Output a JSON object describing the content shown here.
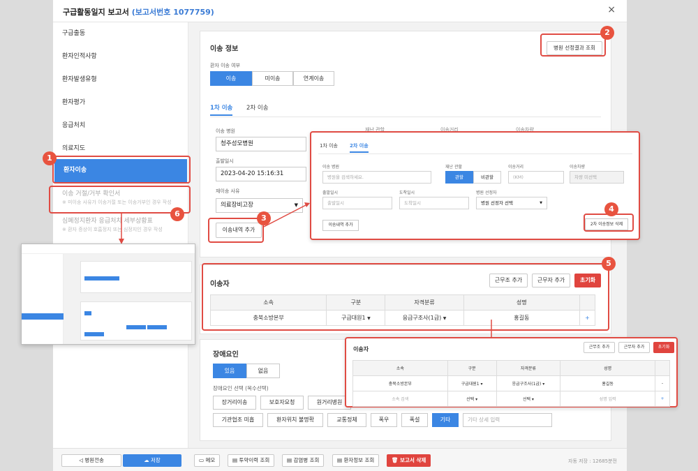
{
  "window": {
    "title": "구급활동일지 보고서",
    "report_no": "(보고서번호 1077759)",
    "close_icon": "×"
  },
  "sidebar": {
    "items": [
      "구급출동",
      "환자인적사항",
      "환자발생유형",
      "환자평가",
      "응급처치",
      "의료지도",
      "환자이송"
    ],
    "refusal_title": "이송 거절/거부 확인서",
    "refusal_note": "※ 미이송 사유가 이송거절 또는 이송거부인 경우 작성",
    "cpr_title": "심폐정지환자 응급처치 세부상황표",
    "cpr_note": "※ 환자 증상이 호흡정지 또는 심정지인 경우 작성"
  },
  "transport": {
    "section_title": "이송 정보",
    "hospital_result_btn": "병원 선정결과 조회",
    "status_label": "환자 이송 여부",
    "status_options": [
      "이송",
      "미이송",
      "연계이송"
    ],
    "tabs": [
      "1차 이송",
      "2차 이송"
    ],
    "hospital_label": "이송 병원",
    "hospital_value": "청주성모병원",
    "depart_label": "출발일시",
    "depart_value": "2023-04-20 15:16:31",
    "reason_label": "재이송 사유",
    "reason_value": "의료장비고장",
    "add_btn": "이송내역 추가",
    "hidden_labels": [
      "재난 관할",
      "이송거리",
      "이송차량"
    ]
  },
  "popup_transport": {
    "tabs": [
      "1차 이송",
      "2차 이송"
    ],
    "hospital_label": "이송 병원",
    "hospital_placeholder": "병원을 검색하세요.",
    "juris_label": "재난 관할",
    "juris_options": [
      "관할",
      "비관할"
    ],
    "distance_label": "이송거리",
    "distance_placeholder": "(KM)",
    "vehicle_label": "이송차량",
    "vehicle_placeholder": "차량 미선택",
    "depart_label": "출발일시",
    "depart_placeholder": "출발일시",
    "arrive_label": "도착일시",
    "arrive_placeholder": "도착일시",
    "selector_label": "병원 선정자",
    "selector_value": "병원 선정자 선택",
    "add_btn": "이송내역 추가",
    "delete_btn": "2차 이송정보 삭제"
  },
  "transporter": {
    "title": "이송자",
    "btn_team": "근무조 추가",
    "btn_worker": "근무자 추가",
    "btn_reset": "초기화",
    "headers": [
      "소속",
      "구분",
      "자격분류",
      "성명"
    ],
    "row": [
      "충북소방본부",
      "구급대원1",
      "응급구조사(1급)",
      "홍길동"
    ],
    "plus": "+"
  },
  "popup_transporter": {
    "title": "이송자",
    "btn_team": "근무조 추가",
    "btn_worker": "근무자 추가",
    "btn_reset": "초기화",
    "headers": [
      "소속",
      "구분",
      "자격분류",
      "성명"
    ],
    "row1": [
      "충북소방본부",
      "구급대원1",
      "응급구조사(1급)",
      "홍길동",
      "-"
    ],
    "row2": [
      "소속 검색",
      "선택",
      "선택",
      "성명 입력",
      "+"
    ]
  },
  "obstacle": {
    "title": "장애요인",
    "options": [
      "있음",
      "없음"
    ],
    "select_label": "장애요인 선택 (복수선택)",
    "row1": [
      "장거리이송",
      "보호자요청",
      "원거리병원"
    ],
    "row2": [
      "기관협조 미흡",
      "환자위치 불명확",
      "교통정체",
      "폭우",
      "폭설",
      "기타"
    ],
    "etc_placeholder": "기타 상세 입력"
  },
  "footer": {
    "send_btn": "병원전송",
    "save_btn": "저장",
    "memo": "메모",
    "med": "투약이력 조회",
    "infect": "감염병 조회",
    "patient": "환자정보 조회",
    "delete": "보고서 삭제",
    "autosave": "자동 저장 : 12685분전"
  },
  "badges": [
    "1",
    "2",
    "3",
    "4",
    "5",
    "6"
  ],
  "colors": {
    "accent": "#3b86e3",
    "annotation": "#e04b43",
    "danger": "#e0443e"
  }
}
